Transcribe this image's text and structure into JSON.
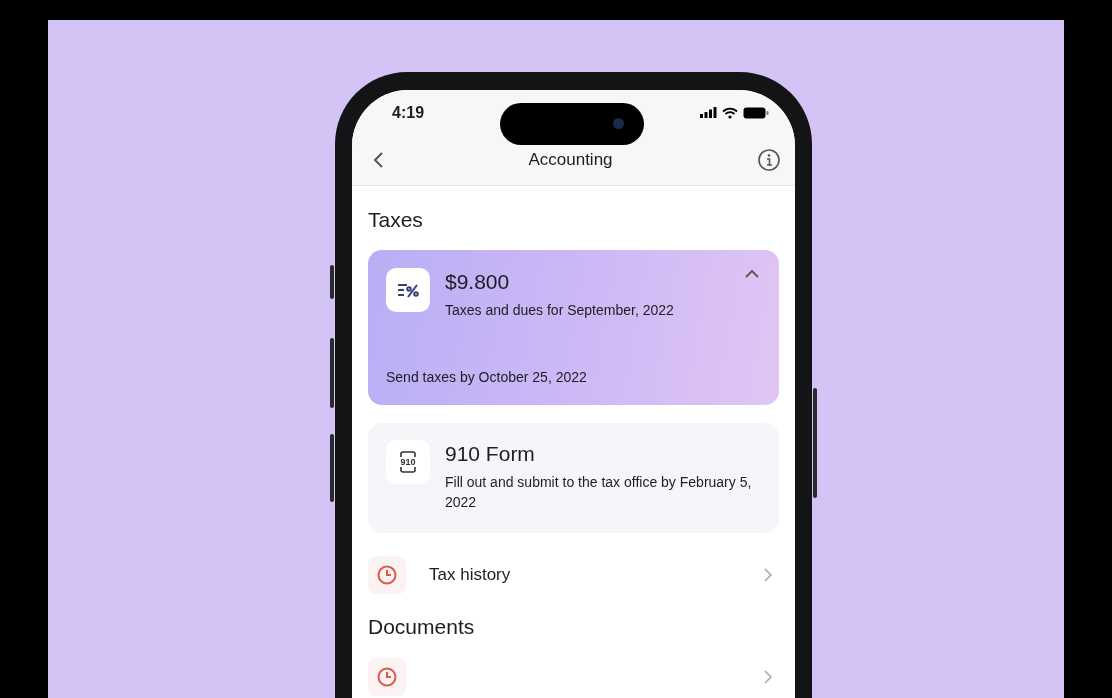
{
  "status_bar": {
    "time": "4:19"
  },
  "nav": {
    "title": "Accounting"
  },
  "sections": [
    {
      "title": "Taxes",
      "items": [
        {
          "kind": "summary",
          "amount": "$9.800",
          "subtitle": "Taxes and dues for September, 2022",
          "footer": "Send taxes by October 25, 2022",
          "expanded": true
        },
        {
          "kind": "form",
          "icon_text": "910",
          "title": "910 Form",
          "subtitle": "Fill out and submit to the tax office by February 5, 2022"
        },
        {
          "kind": "link",
          "label": "Tax history"
        }
      ]
    },
    {
      "title": "Documents",
      "items": [
        {
          "kind": "link"
        }
      ]
    }
  ]
}
